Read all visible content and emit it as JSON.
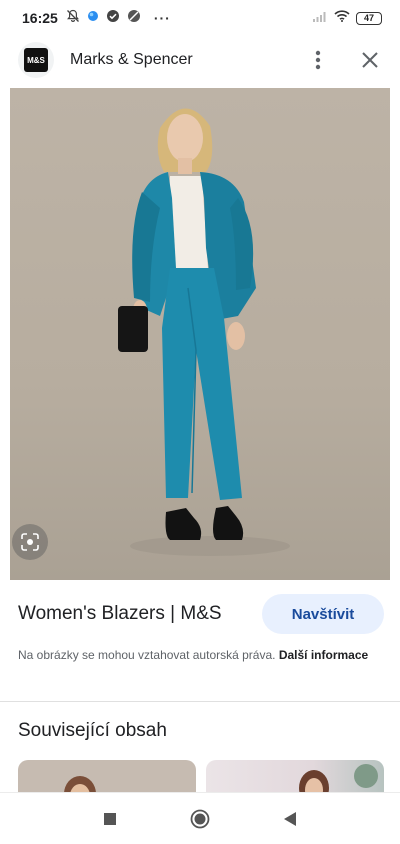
{
  "status_bar": {
    "time": "16:25",
    "battery": "47",
    "more": "···",
    "icons_left": [
      "notifications-off-icon",
      "app-dot-icon",
      "check-circle-icon",
      "blocked-icon"
    ],
    "icons_right": [
      "signal-icon",
      "wifi-icon",
      "battery-icon"
    ]
  },
  "header": {
    "logo_text": "M&S",
    "site_name": "Marks & Spencer",
    "icons": [
      "more-vert-icon",
      "close-icon"
    ]
  },
  "image": {
    "description_icon": "lens-icon"
  },
  "info": {
    "title": "Women's Blazers | M&S",
    "visit_label": "Navštívit",
    "copyright_text": "Na obrázky se mohou vztahovat autorská práva.",
    "more_info_label": "Další informace"
  },
  "related": {
    "title": "Související obsah"
  },
  "nav": {
    "icons": [
      "recents-icon",
      "home-icon",
      "back-icon"
    ]
  },
  "colors": {
    "accent": "#1a4b9c",
    "visit_bg": "#e8f0fe",
    "suit": "#1e88a8"
  }
}
